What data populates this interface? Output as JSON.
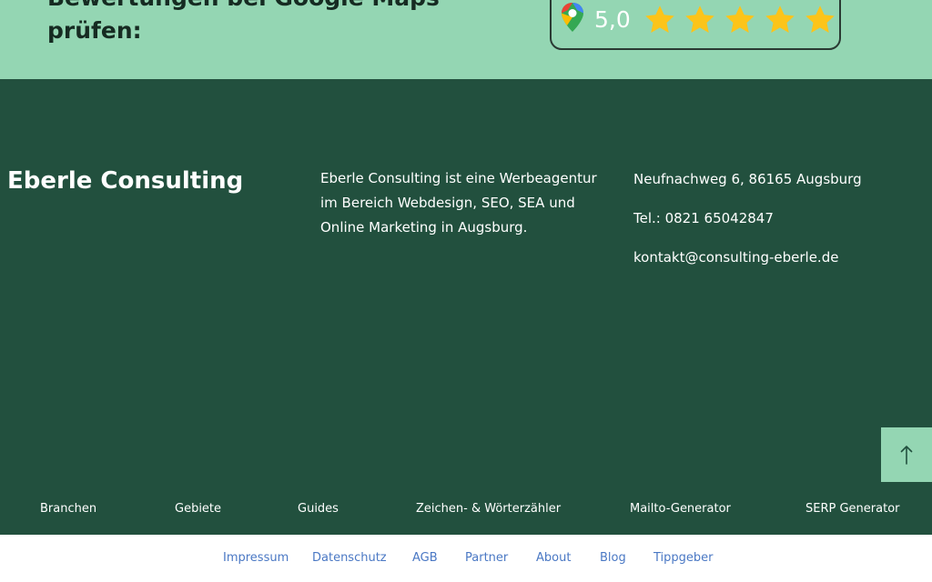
{
  "reviews": {
    "heading": "Bewertungen bei Google Maps prüfen:",
    "rating": "5,0",
    "stars": 5,
    "star_color": "#fcc419",
    "pin_icon": "google-maps-pin-icon"
  },
  "footer": {
    "brand": "Eberle Consulting",
    "about": "Eberle Consulting ist eine Werbeagentur im Bereich Webdesign, SEO, SEA und Online Marketing in Augsburg.",
    "address": "Neufnachweg 6, 86165 Augsburg",
    "phone": "Tel.: 0821 65042847",
    "email": "kontakt@consulting-eberle.de",
    "scroll_top_icon": "arrow-up-icon",
    "nav": [
      "Branchen",
      "Gebiete",
      "Guides",
      "Zeichen- & Wörterzähler",
      "Mailto-Generator",
      "SERP Generator"
    ],
    "legal": [
      "Impressum",
      "Datenschutz",
      "AGB",
      "Partner",
      "About",
      "Blog",
      "Tippgeber"
    ]
  },
  "colors": {
    "mint": "#94d6b3",
    "dark_green": "#22503e",
    "link_blue": "#4a78c4"
  }
}
